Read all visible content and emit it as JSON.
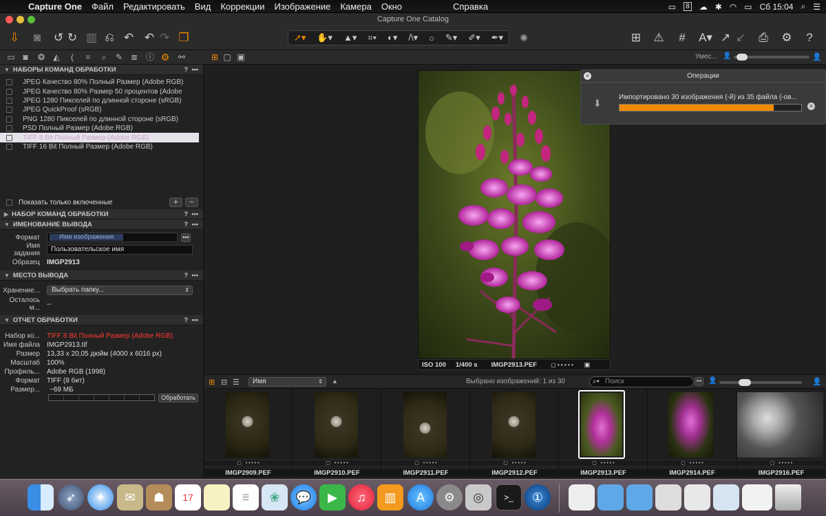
{
  "menubar": {
    "app": "Capture One",
    "items": [
      "Файл",
      "Редактировать",
      "Вид",
      "Коррекции",
      "Изображение",
      "Камера",
      "Окно",
      "Справка"
    ],
    "clock": "Сб 15:04",
    "notif_badge": "8"
  },
  "window": {
    "title": "Capture One Catalog"
  },
  "left": {
    "sec_recipes": "НАБОРЫ КОМАНД ОБРАБОТКИ",
    "recipes": [
      "JPEG Качество 80% Полный Размер (Adobe RGB)",
      "JPEG Качество 80% Размер 50 процентов (Adobe",
      "JPEG 1280 Пикселей по длинной стороне (sRGB)",
      "JPEG QuickProof (sRGB)",
      "PNG 1280 Пикселей по длинной стороне (sRGB)",
      "PSD Полный Размер (Adobe RGB)",
      "TIFF 8 Bit Полный Размер (Adobe RGB)",
      "TIFF 16 Bit Полный Размер (Adobe RGB)"
    ],
    "show_enabled_only": "Показать только включенные",
    "sec_recipe": "НАБОР КОМАНД ОБРАБОТКИ",
    "sec_naming": "ИМЕНОВАНИЕ ВЫВОДА",
    "format_label": "Формат",
    "format_token": "Имя изображения",
    "job_label": "Имя задания",
    "job_value": "Пользовательское имя",
    "sample_label": "Образец",
    "sample_value": "IMGP2913",
    "sec_location": "МЕСТО ВЫВОДА",
    "storage_label": "Хранение...",
    "storage_value": "Выбрать папку...",
    "remaining_label": "Осталось м...",
    "remaining_value": "--",
    "sec_summary": "ОТЧЕТ ОБРАБОТКИ",
    "summary": [
      {
        "k": "Набор ко...",
        "v": "TIFF 8 Bit Полный Размер (Adobe RGB)"
      },
      {
        "k": "Имя файла",
        "v": "IMGP2913.tif"
      },
      {
        "k": "Размер",
        "v": "13,33 x 20,05 дюйм (4000 x 6016 px)"
      },
      {
        "k": "Масштаб",
        "v": "100%"
      },
      {
        "k": "Профиль...",
        "v": "Adobe RGB (1998)"
      },
      {
        "k": "Формат",
        "v": "TIFF (8 бит)"
      },
      {
        "k": "Размер...",
        "v": "~69 МБ"
      }
    ],
    "process_button": "Обработать",
    "help": "?",
    "more": "•••"
  },
  "viewer": {
    "iso": "ISO 100",
    "shutter": "1/400 s",
    "filename": "IMGP2913.PEF",
    "zoom_label": "Умес..."
  },
  "operations": {
    "title": "Операции",
    "message": "Импортировано 30 изображения (-й) из 35 файла (-ов...",
    "progress": 0.85
  },
  "browser": {
    "sort": "Имя",
    "selection": "Выбрано изображений: 1 из 30",
    "search_placeholder": "Поиск",
    "thumbs": [
      "IMGP2909.PEF",
      "IMGP2910.PEF",
      "IMGP2911.PEF",
      "IMGP2912.PEF",
      "IMGP2913.PEF",
      "IMGP2914.PEF",
      "IMGP2916.PEF"
    ]
  },
  "colors": {
    "accent": "#f28a00",
    "red_text": "#ff3b2e",
    "selection": "#ffffff"
  }
}
